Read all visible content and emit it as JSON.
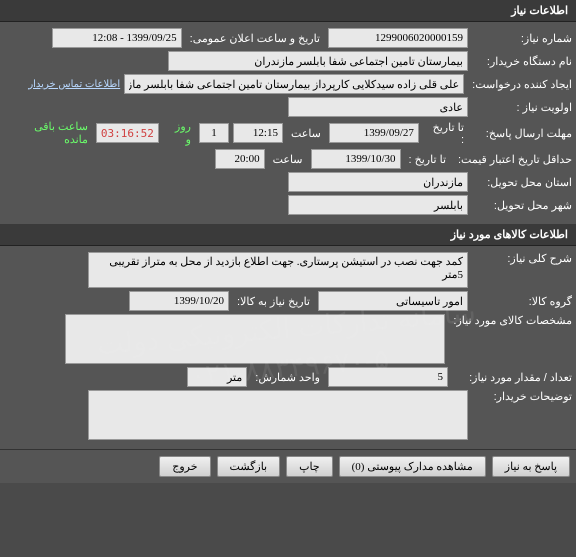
{
  "section1": {
    "title": "اطلاعات نیاز",
    "fields": {
      "req_no_label": "شماره نیاز:",
      "req_no": "1299006020000159",
      "announce_label": "تاریخ و ساعت اعلان عمومی:",
      "announce_value": "1399/09/25 - 12:08",
      "buyer_label": "نام دستگاه خریدار:",
      "buyer": "بیمارستان تامین اجتماعی شفا بابلسر مازندران",
      "creator_label": "ایجاد کننده درخواست:",
      "creator": "علی قلی زاده سیدکلایی کارپرداز بیمارستان تامین اجتماعی شفا بابلسر مازندران",
      "contact_link": "اطلاعات تماس خریدار",
      "priority_label": "اولویت نیاز :",
      "priority": "عادی",
      "deadline_label": "مهلت ارسال پاسخ:",
      "to_date_label": "تا تاریخ :",
      "deadline_date": "1399/09/27",
      "time_label": "ساعت",
      "deadline_time": "12:15",
      "days": "1",
      "days_label": "روز و",
      "countdown": "03:16:52",
      "remaining_label": "ساعت باقی مانده",
      "min_valid_label": "حداقل تاریخ اعتبار قیمت:",
      "min_valid_date": "1399/10/30",
      "min_valid_time": "20:00",
      "province_label": "استان محل تحویل:",
      "province": "مازندران",
      "city_label": "شهر محل تحویل:",
      "city": "بابلسر"
    }
  },
  "section2": {
    "title": "اطلاعات کالاهای مورد نیاز",
    "fields": {
      "desc_label": "شرح کلی نیاز:",
      "desc": "کمد جهت نصب در استیشن پرستاری. جهت اطلاع بازدید از محل به متراز تقریبی 5متر",
      "group_label": "گروه کالا:",
      "group": "امور تاسیساتی",
      "need_date_label": "تاریخ نیاز به کالا:",
      "need_date": "1399/10/20",
      "spec_label": "مشخصات کالای مورد نیاز:",
      "spec": "",
      "qty_label": "تعداد / مقدار مورد نیاز:",
      "qty": "5",
      "unit_label": "واحد شمارش:",
      "unit": "متر",
      "notes_label": "توضیحات خریدار:",
      "notes": ""
    },
    "watermark_line1": "سامانه تدارکات الکترونیکی دولت",
    "watermark_line2": "۰۲۱-۸۸۳۴۹۶۷۰-۵"
  },
  "buttons": {
    "respond": "پاسخ به نیاز",
    "attachments": "مشاهده مدارک پیوستی (0)",
    "print": "چاپ",
    "back": "بازگشت",
    "exit": "خروج"
  }
}
